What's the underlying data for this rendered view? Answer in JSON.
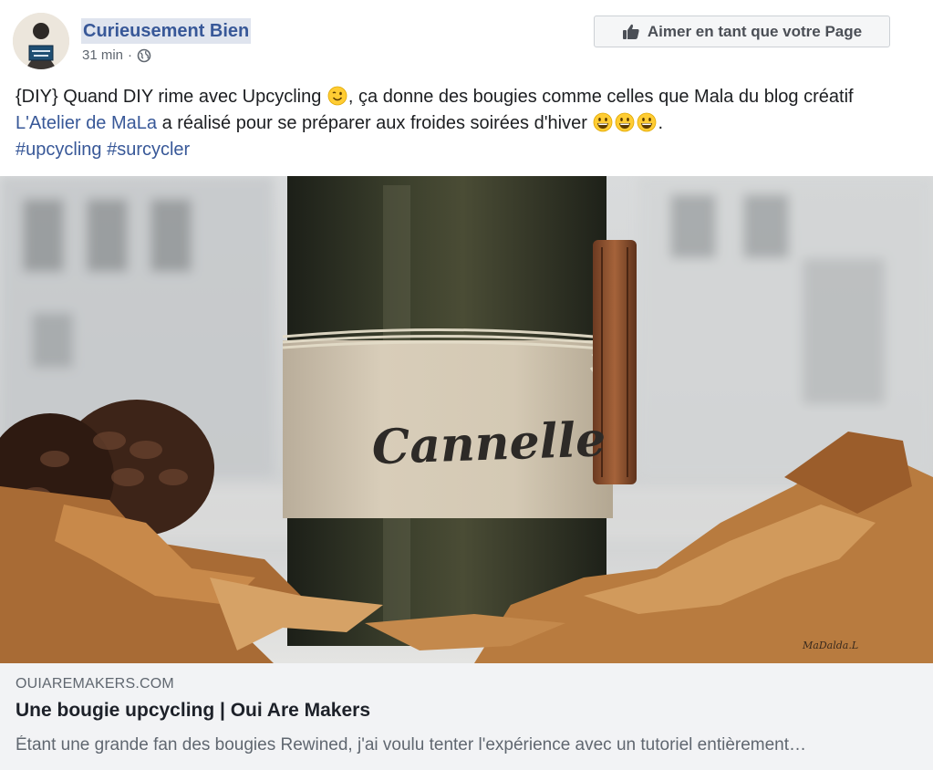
{
  "post": {
    "author": "Curieusement Bien",
    "time": "31 min",
    "separator": "·",
    "like_page_label": "Aimer en tant que votre Page",
    "text": {
      "part1": "{DIY} Quand DIY rime avec Upcycling ",
      "part2": ", ça donne des bougies comme celles que Mala du blog créatif ",
      "link": "L'Atelier de MaLa",
      "part3": " a réalisé pour se préparer aux froides soirées d'hiver ",
      "part4": ".",
      "hashtags": [
        "#upcycling",
        "#surcycler"
      ]
    }
  },
  "image": {
    "label_text": "Cannelle",
    "watermark": "MaDalda.L"
  },
  "link_preview": {
    "domain": "OUIAREMAKERS.COM",
    "title": "Une bougie upcycling | Oui Are Makers",
    "description": "Étant une grande fan des bougies Rewined, j'ai voulu tenter l'expérience avec un tutoriel entièrement…"
  },
  "colors": {
    "link": "#385898",
    "preview_bg": "#f2f3f5"
  },
  "icons": {
    "audience": "globe-icon",
    "like": "thumbs-up-icon",
    "emoji_wink": "winking-face-emoji",
    "emoji_grin": "grinning-face-emoji"
  }
}
